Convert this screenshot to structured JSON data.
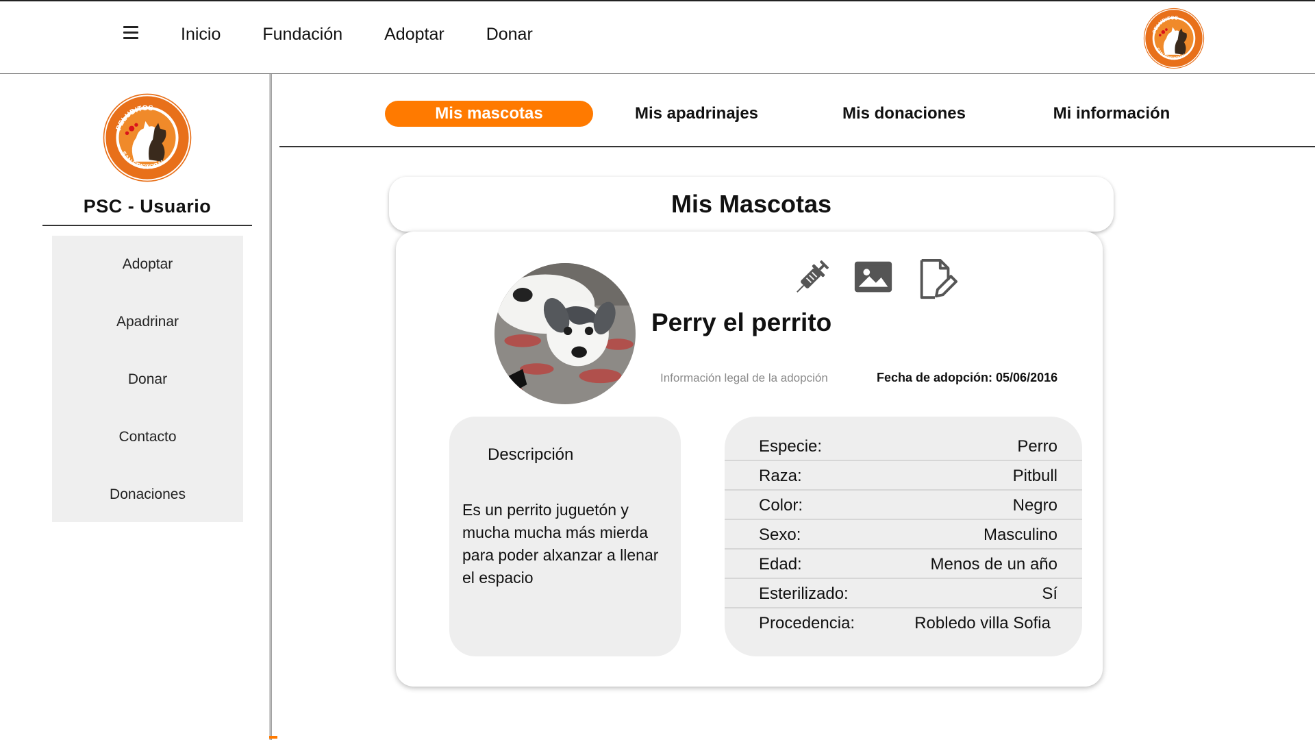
{
  "topnav": {
    "items": [
      "Inicio",
      "Fundación",
      "Adoptar",
      "Donar"
    ]
  },
  "sidebar": {
    "title": "PSC - Usuario",
    "menu": [
      "Adoptar",
      "Apadrinar",
      "Donar",
      "Contacto",
      "Donaciones"
    ]
  },
  "logo": {
    "text_top": "PELUDITOS",
    "text_bottom": "SAN CRISTOBAL"
  },
  "tabs": [
    "Mis mascotas",
    "Mis apadrinajes",
    "Mis donaciones",
    "Mi información"
  ],
  "active_tab": 0,
  "page": {
    "title": "Mis Mascotas"
  },
  "pet": {
    "name": "Perry el perrito",
    "legal_link": "Información legal de la adopción",
    "adoption_date": "Fecha de adopción: 05/06/2016",
    "description_title": "Descripción",
    "description": "Es un perrito juguetón y mucha mucha más mierda para poder alxanzar a llenar el espacio",
    "attributes": [
      {
        "label": "Especie:",
        "value": "Perro"
      },
      {
        "label": "Raza:",
        "value": "Pitbull"
      },
      {
        "label": "Color:",
        "value": "Negro"
      },
      {
        "label": "Sexo:",
        "value": "Masculino"
      },
      {
        "label": "Edad:",
        "value": "Menos de un año"
      },
      {
        "label": "Esterilizado:",
        "value": "Sí"
      },
      {
        "label": "Procedencia:",
        "value": "Robledo villa Sofia"
      }
    ]
  },
  "icons": [
    "menu-icon",
    "syringe-icon",
    "image-icon",
    "edit-document-icon"
  ],
  "colors": {
    "accent": "#ff7a00",
    "panel": "#eeeeee",
    "sidebar_panel": "#efefef",
    "muted_text": "#8a8a8a"
  }
}
